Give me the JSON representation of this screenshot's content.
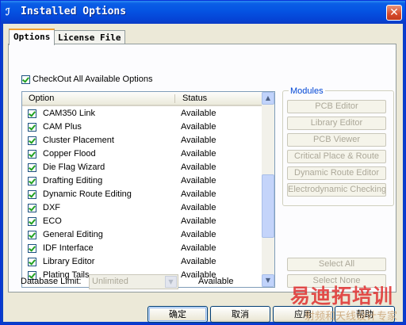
{
  "window": {
    "title": "Installed Options",
    "icon": "app-icon",
    "close_glyph": "✕"
  },
  "tabs": [
    {
      "label": "Options",
      "active": true
    },
    {
      "label": "License File",
      "active": false
    }
  ],
  "checkout_all": {
    "label": "CheckOut All Available Options",
    "checked": true
  },
  "list": {
    "columns": {
      "option": "Option",
      "status": "Status"
    },
    "rows": [
      {
        "option": "CAM350 Link",
        "status": "Available",
        "checked": true
      },
      {
        "option": "CAM Plus",
        "status": "Available",
        "checked": true
      },
      {
        "option": "Cluster Placement",
        "status": "Available",
        "checked": true
      },
      {
        "option": "Copper Flood",
        "status": "Available",
        "checked": true
      },
      {
        "option": "Die Flag Wizard",
        "status": "Available",
        "checked": true
      },
      {
        "option": "Drafting Editing",
        "status": "Available",
        "checked": true
      },
      {
        "option": "Dynamic Route Editing",
        "status": "Available",
        "checked": true
      },
      {
        "option": "DXF",
        "status": "Available",
        "checked": true
      },
      {
        "option": "ECO",
        "status": "Available",
        "checked": true
      },
      {
        "option": "General Editing",
        "status": "Available",
        "checked": true
      },
      {
        "option": "IDF Interface",
        "status": "Available",
        "checked": true
      },
      {
        "option": "Library Editor",
        "status": "Available",
        "checked": true
      },
      {
        "option": "Plating Tails",
        "status": "Available",
        "checked": true
      }
    ]
  },
  "modules": {
    "legend": "Modules",
    "buttons": [
      "PCB Editor",
      "Library Editor",
      "PCB Viewer",
      "Critical Place & Route",
      "Dynamic Route Editor",
      "Electrodynamic Checking"
    ]
  },
  "select_all": "Select All",
  "select_none": "Select None",
  "database": {
    "label": "Database Limit:",
    "value": "Unlimited",
    "status": "Available"
  },
  "dialog_buttons": {
    "ok": "确定",
    "cancel": "取消",
    "apply": "应用",
    "help": "帮助"
  },
  "watermark": {
    "line1": "易迪拓培训",
    "line2": "射频和天线设计专家"
  },
  "colors": {
    "title_bar": "#0553e2",
    "close_button": "#d6492a",
    "accent_tab": "#f0a030",
    "group_legend": "#0046d5"
  }
}
